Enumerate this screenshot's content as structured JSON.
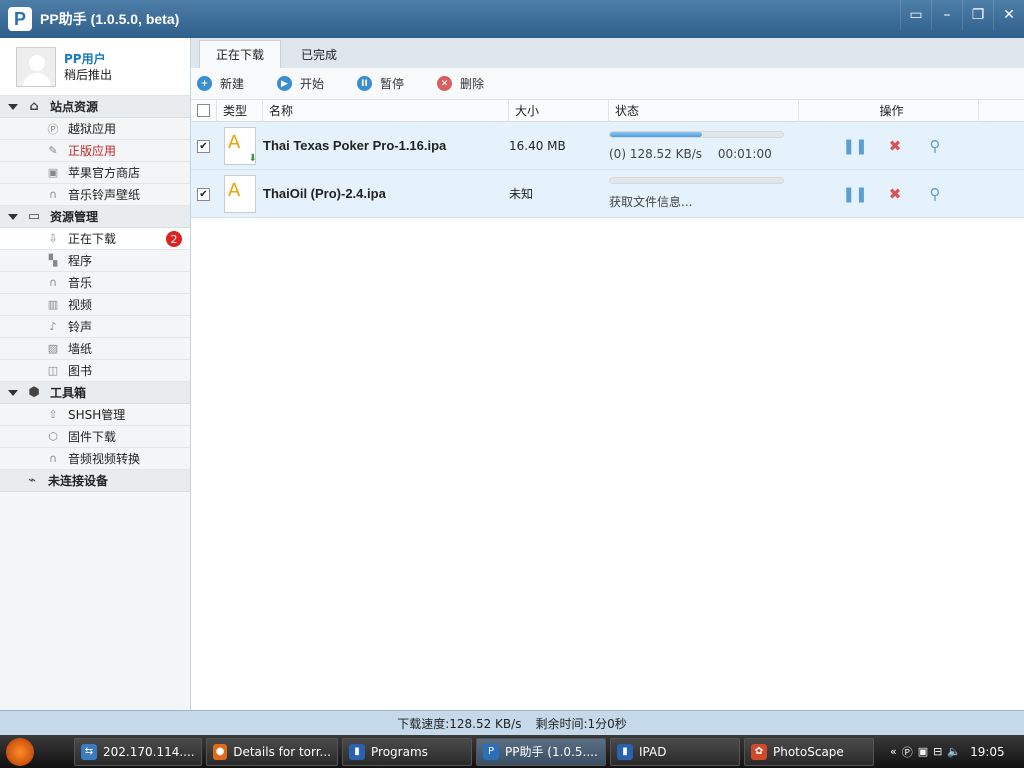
{
  "app": {
    "title": "PP助手 (1.0.5.0, beta)",
    "logo": "P"
  },
  "window_controls": [
    "menu-icon",
    "minimize-icon",
    "restore-icon",
    "close-icon"
  ],
  "user": {
    "name": "PP用户",
    "status": "稍后推出"
  },
  "sidebar": {
    "sections": [
      {
        "title": "站点资源",
        "icon": "home-icon",
        "items": [
          {
            "label": "越狱应用",
            "icon": "p-icon"
          },
          {
            "label": "正版应用",
            "icon": "pen-icon"
          },
          {
            "label": "苹果官方商店",
            "icon": "store-icon"
          },
          {
            "label": "音乐铃声壁纸",
            "icon": "headphones-icon"
          }
        ]
      },
      {
        "title": "资源管理",
        "icon": "monitor-icon",
        "items": [
          {
            "label": "正在下载",
            "icon": "download-icon",
            "badge": "2"
          },
          {
            "label": "程序",
            "icon": "grid-icon"
          },
          {
            "label": "音乐",
            "icon": "headphones-icon"
          },
          {
            "label": "视频",
            "icon": "film-icon"
          },
          {
            "label": "铃声",
            "icon": "note-icon"
          },
          {
            "label": "墙纸",
            "icon": "image-icon"
          },
          {
            "label": "图书",
            "icon": "book-icon"
          }
        ]
      },
      {
        "title": "工具箱",
        "icon": "toolbox-icon",
        "items": [
          {
            "label": "SHSH管理",
            "icon": "upload-icon"
          },
          {
            "label": "固件下载",
            "icon": "box-icon"
          },
          {
            "label": "音频视频转换",
            "icon": "headphones-icon"
          }
        ]
      }
    ],
    "device": "未连接设备"
  },
  "tabs": [
    "正在下载",
    "已完成"
  ],
  "toolbar": {
    "new": "新建",
    "start": "开始",
    "pause": "暂停",
    "delete": "删除"
  },
  "columns": {
    "type": "类型",
    "name": "名称",
    "size": "大小",
    "status": "状态",
    "action": "操作"
  },
  "downloads": [
    {
      "name": "Thai Texas Poker Pro-1.16.ipa",
      "size": "16.40 MB",
      "progress": 0.53,
      "speed": "(0) 128.52 KB/s",
      "time": "00:01:00"
    },
    {
      "name": "ThaiOil (Pro)-2.4.ipa",
      "size": "未知",
      "progress": 0,
      "speed": "获取文件信息...",
      "time": ""
    }
  ],
  "status_bar": {
    "speed": "下载速度:128.52 KB/s",
    "remaining": "剩余时间:1分0秒"
  },
  "taskbar": {
    "tasks": [
      {
        "label": "202.170.114....",
        "color": "#3b7bbf"
      },
      {
        "label": "Details for torr...",
        "color": "#e06a1a"
      },
      {
        "label": "Programs",
        "color": "#2a62b0"
      },
      {
        "label": "PP助手 (1.0.5....",
        "color": "#2a6fb8"
      },
      {
        "label": "IPAD",
        "color": "#2a62b0"
      },
      {
        "label": "PhotoScape",
        "color": "#d04a2a"
      }
    ],
    "clock": "19:05"
  },
  "colors": {
    "accent": "#2f5f8b",
    "progress": "#4f9fdb",
    "pause": "#5b9fcf",
    "delete": "#e05050"
  }
}
